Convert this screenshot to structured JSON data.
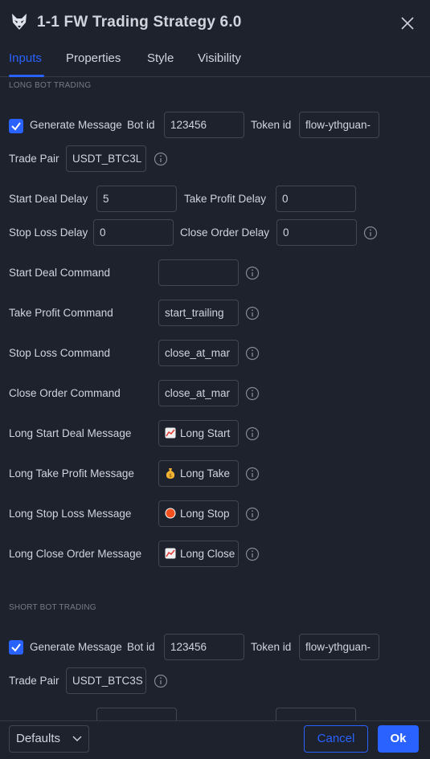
{
  "dialog": {
    "title": "1-1 FW Trading Strategy 6.0"
  },
  "tabs": [
    "Inputs",
    "Properties",
    "Style",
    "Visibility"
  ],
  "long": {
    "section": "LONG BOT TRADING",
    "generate_label": "Generate Message",
    "bot_id_label": "Bot id",
    "bot_id_value": "123456",
    "token_id_label": "Token id",
    "token_id_value": "flow-ythguan-",
    "trade_pair_label": "Trade Pair",
    "trade_pair_value": "USDT_BTC3L",
    "start_deal_delay_label": "Start Deal Delay",
    "start_deal_delay_value": "5",
    "take_profit_delay_label": "Take Profit Delay",
    "take_profit_delay_value": "0",
    "stop_loss_delay_label": "Stop Loss Delay",
    "stop_loss_delay_value": "0",
    "close_order_delay_label": "Close Order Delay",
    "close_order_delay_value": "0",
    "start_deal_command_label": "Start Deal Command",
    "start_deal_command_value": "",
    "take_profit_command_label": "Take Profit Command",
    "take_profit_command_value": "start_trailing",
    "stop_loss_command_label": "Stop Loss Command",
    "stop_loss_command_value": "close_at_mar",
    "close_order_command_label": "Close Order Command",
    "close_order_command_value": "close_at_mar",
    "start_deal_message_label": "Long Start Deal Message",
    "start_deal_message_value": "Long Start",
    "take_profit_message_label": "Long Take Profit Message",
    "take_profit_message_value": "Long Take",
    "stop_loss_message_label": "Long Stop Loss Message",
    "stop_loss_message_value": "Long Stop",
    "close_order_message_label": "Long Close Order Message",
    "close_order_message_value": "Long Close"
  },
  "short": {
    "section": "SHORT BOT TRADING",
    "generate_label": "Generate Message",
    "bot_id_label": "Bot id",
    "bot_id_value": "123456",
    "token_id_label": "Token id",
    "token_id_value": "flow-ythguan-",
    "trade_pair_label": "Trade Pair",
    "trade_pair_value": "USDT_BTC3S"
  },
  "footer": {
    "defaults_label": "Defaults",
    "cancel_label": "Cancel",
    "ok_label": "Ok"
  },
  "colors": {
    "accent": "#2962ff",
    "background": "#1e222d",
    "border": "#434651",
    "text": "#d1d4dc",
    "muted": "#787b86"
  },
  "icons": [
    "wolf-logo-icon",
    "close-icon",
    "checkbox-checked-icon",
    "info-icon",
    "chart-up-icon",
    "money-bag-icon",
    "red-circle-icon",
    "chevron-down-icon"
  ]
}
